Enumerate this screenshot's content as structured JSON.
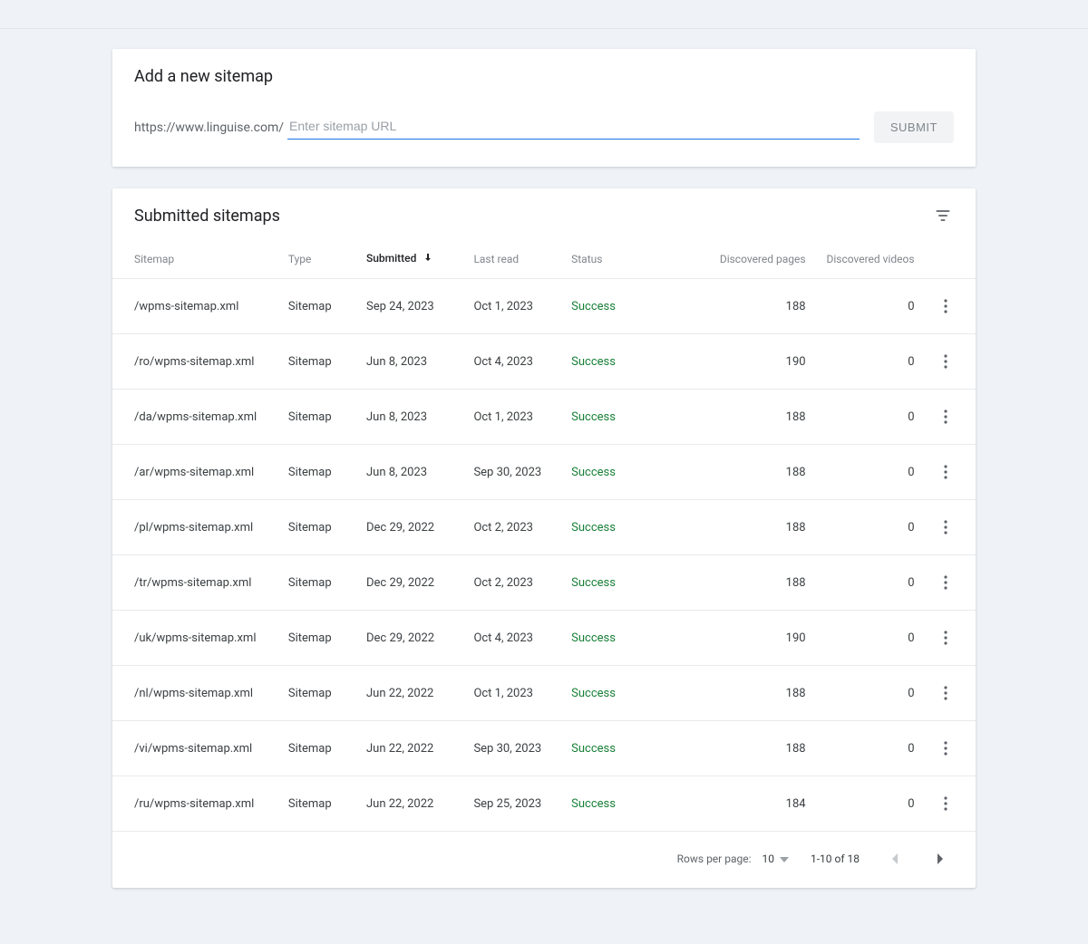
{
  "add": {
    "title": "Add a new sitemap",
    "url_prefix": "https://www.linguise.com/",
    "placeholder": "Enter sitemap URL",
    "submit_label": "SUBMIT"
  },
  "list": {
    "title": "Submitted sitemaps",
    "columns": {
      "sitemap": "Sitemap",
      "type": "Type",
      "submitted": "Submitted",
      "last_read": "Last read",
      "status": "Status",
      "discovered_pages": "Discovered pages",
      "discovered_videos": "Discovered videos"
    },
    "rows": [
      {
        "sitemap": "/wpms-sitemap.xml",
        "type": "Sitemap",
        "submitted": "Sep 24, 2023",
        "last_read": "Oct 1, 2023",
        "status": "Success",
        "pages": "188",
        "videos": "0"
      },
      {
        "sitemap": "/ro/wpms-sitemap.xml",
        "type": "Sitemap",
        "submitted": "Jun 8, 2023",
        "last_read": "Oct 4, 2023",
        "status": "Success",
        "pages": "190",
        "videos": "0"
      },
      {
        "sitemap": "/da/wpms-sitemap.xml",
        "type": "Sitemap",
        "submitted": "Jun 8, 2023",
        "last_read": "Oct 1, 2023",
        "status": "Success",
        "pages": "188",
        "videos": "0"
      },
      {
        "sitemap": "/ar/wpms-sitemap.xml",
        "type": "Sitemap",
        "submitted": "Jun 8, 2023",
        "last_read": "Sep 30, 2023",
        "status": "Success",
        "pages": "188",
        "videos": "0"
      },
      {
        "sitemap": "/pl/wpms-sitemap.xml",
        "type": "Sitemap",
        "submitted": "Dec 29, 2022",
        "last_read": "Oct 2, 2023",
        "status": "Success",
        "pages": "188",
        "videos": "0"
      },
      {
        "sitemap": "/tr/wpms-sitemap.xml",
        "type": "Sitemap",
        "submitted": "Dec 29, 2022",
        "last_read": "Oct 2, 2023",
        "status": "Success",
        "pages": "188",
        "videos": "0"
      },
      {
        "sitemap": "/uk/wpms-sitemap.xml",
        "type": "Sitemap",
        "submitted": "Dec 29, 2022",
        "last_read": "Oct 4, 2023",
        "status": "Success",
        "pages": "190",
        "videos": "0"
      },
      {
        "sitemap": "/nl/wpms-sitemap.xml",
        "type": "Sitemap",
        "submitted": "Jun 22, 2022",
        "last_read": "Oct 1, 2023",
        "status": "Success",
        "pages": "188",
        "videos": "0"
      },
      {
        "sitemap": "/vi/wpms-sitemap.xml",
        "type": "Sitemap",
        "submitted": "Jun 22, 2022",
        "last_read": "Sep 30, 2023",
        "status": "Success",
        "pages": "188",
        "videos": "0"
      },
      {
        "sitemap": "/ru/wpms-sitemap.xml",
        "type": "Sitemap",
        "submitted": "Jun 22, 2022",
        "last_read": "Sep 25, 2023",
        "status": "Success",
        "pages": "184",
        "videos": "0"
      }
    ]
  },
  "pagination": {
    "rows_label": "Rows per page:",
    "page_size": "10",
    "range": "1-10 of 18"
  }
}
